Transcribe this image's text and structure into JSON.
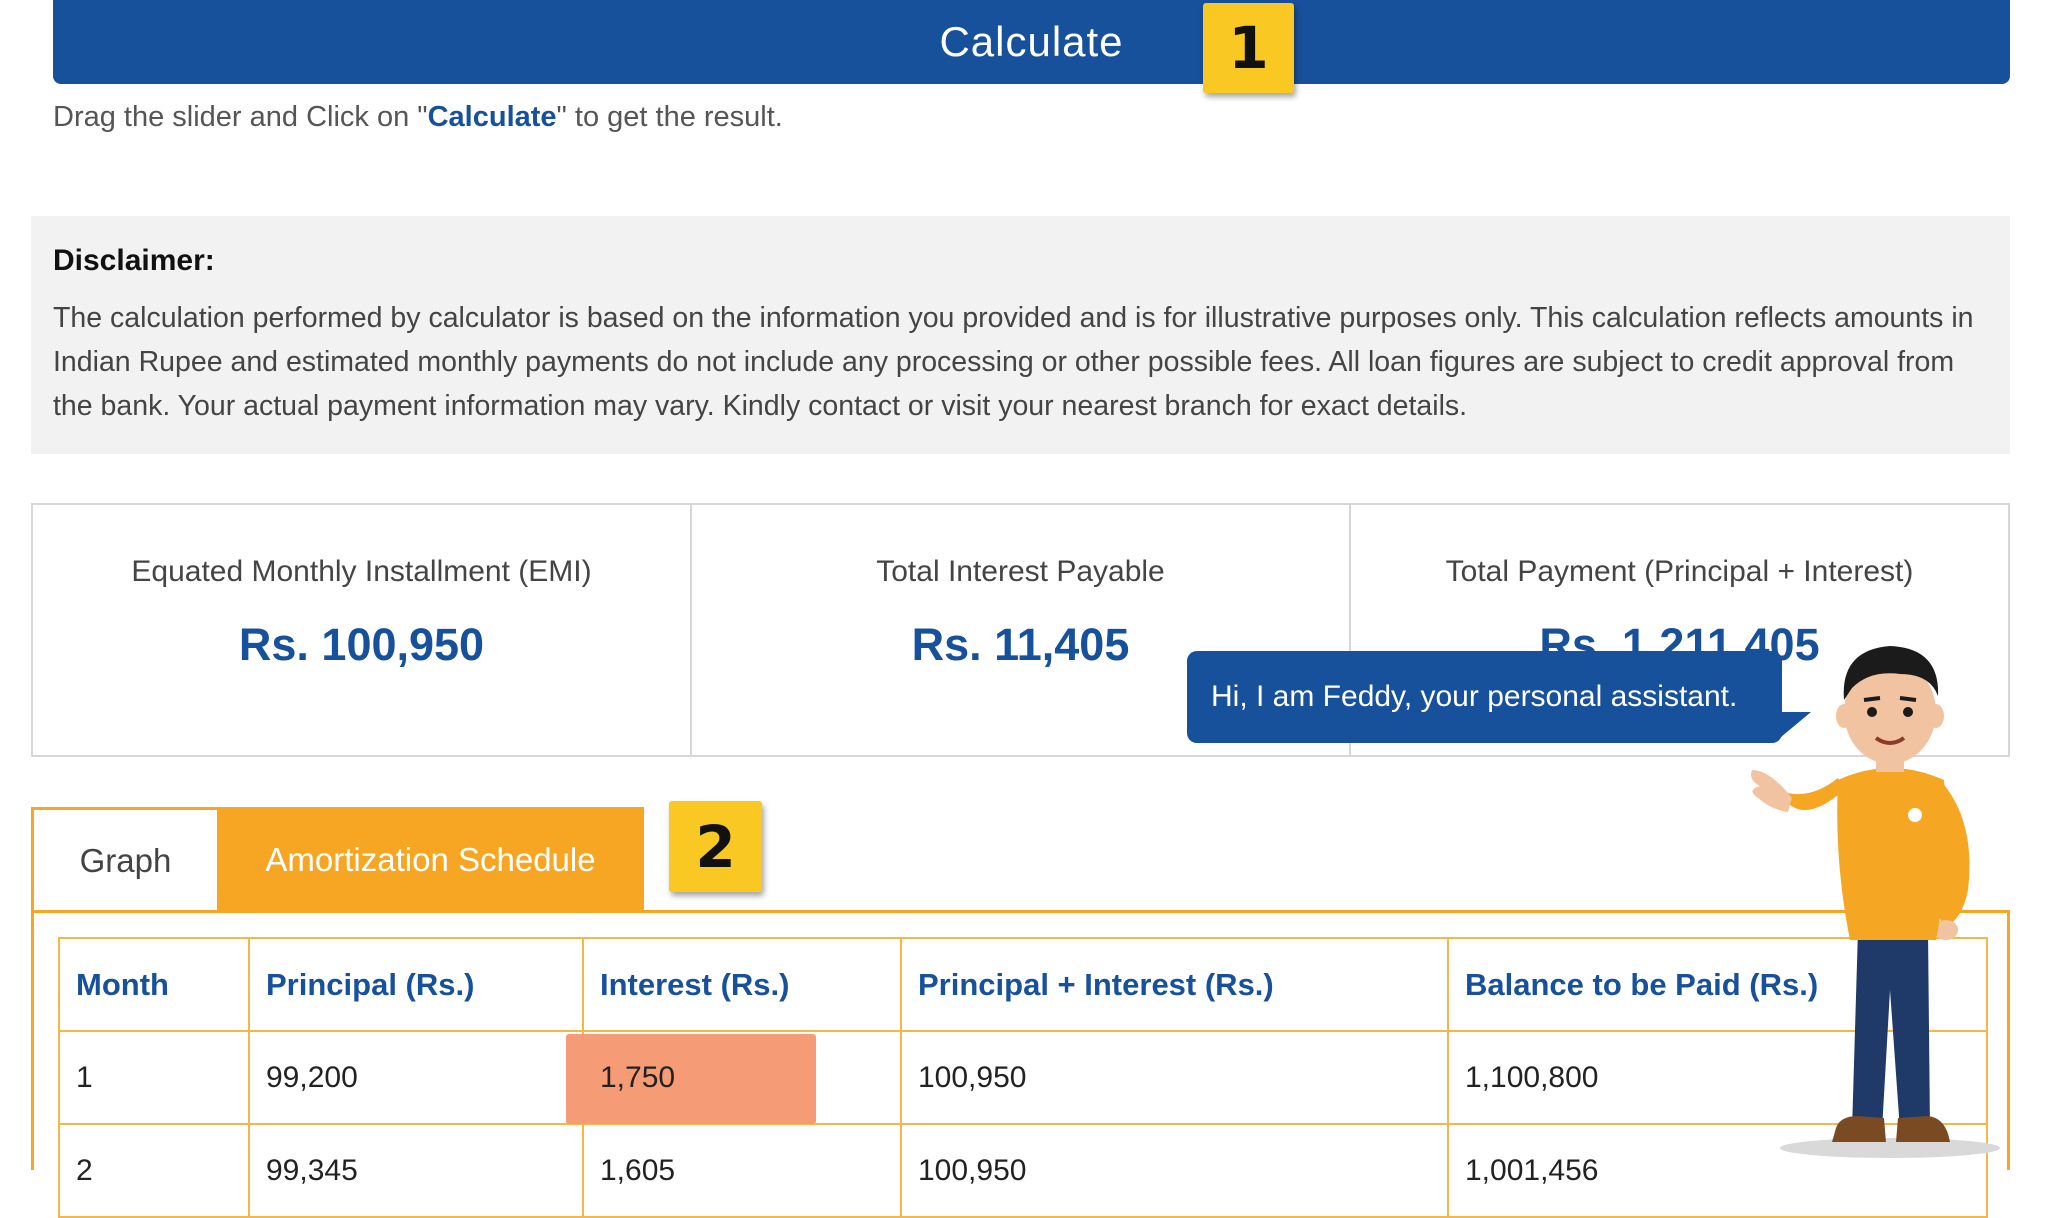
{
  "calculate": {
    "label": "Calculate",
    "badge": "1"
  },
  "hint": {
    "prefix": "Drag the slider and Click on \"",
    "highlight": "Calculate",
    "suffix": "\" to get the result."
  },
  "disclaimer": {
    "title": "Disclaimer:",
    "text": "The calculation performed by calculator is based on the information you provided and is for illustrative purposes only. This calculation reflects amounts in Indian Rupee and estimated monthly payments do not include any processing or other possible fees. All loan figures are subject to credit approval from the bank. Your actual payment information may vary. Kindly contact or visit your nearest branch for exact details."
  },
  "summary": [
    {
      "label": "Equated Monthly Installment (EMI)",
      "value": "Rs. 100,950"
    },
    {
      "label": "Total Interest Payable",
      "value": "Rs. 11,405"
    },
    {
      "label": "Total Payment (Principal + Interest)",
      "value": "Rs. 1,211,405"
    }
  ],
  "tabs": {
    "graph": "Graph",
    "amortization": "Amortization Schedule",
    "active": "amortization",
    "badge": "2"
  },
  "assistant": {
    "message": "Hi, I am Feddy, your personal assistant.",
    "icon": "mascot-character"
  },
  "table": {
    "headers": [
      "Month",
      "Principal (Rs.)",
      "Interest (Rs.)",
      "Principal + Interest (Rs.)",
      "Balance to be Paid (Rs.)"
    ],
    "rows": [
      [
        "1",
        "99,200",
        "1,750",
        "100,950",
        "1,100,800"
      ],
      [
        "2",
        "99,345",
        "1,605",
        "100,950",
        "1,001,456"
      ]
    ],
    "highlighted_cell": "1,750"
  },
  "colors": {
    "primary_blue": "#17519b",
    "tab_orange": "#f6a623",
    "badge_yellow": "#f9c823",
    "highlight_salmon": "#f59b75",
    "disclaimer_bg": "#f2f2f2"
  }
}
